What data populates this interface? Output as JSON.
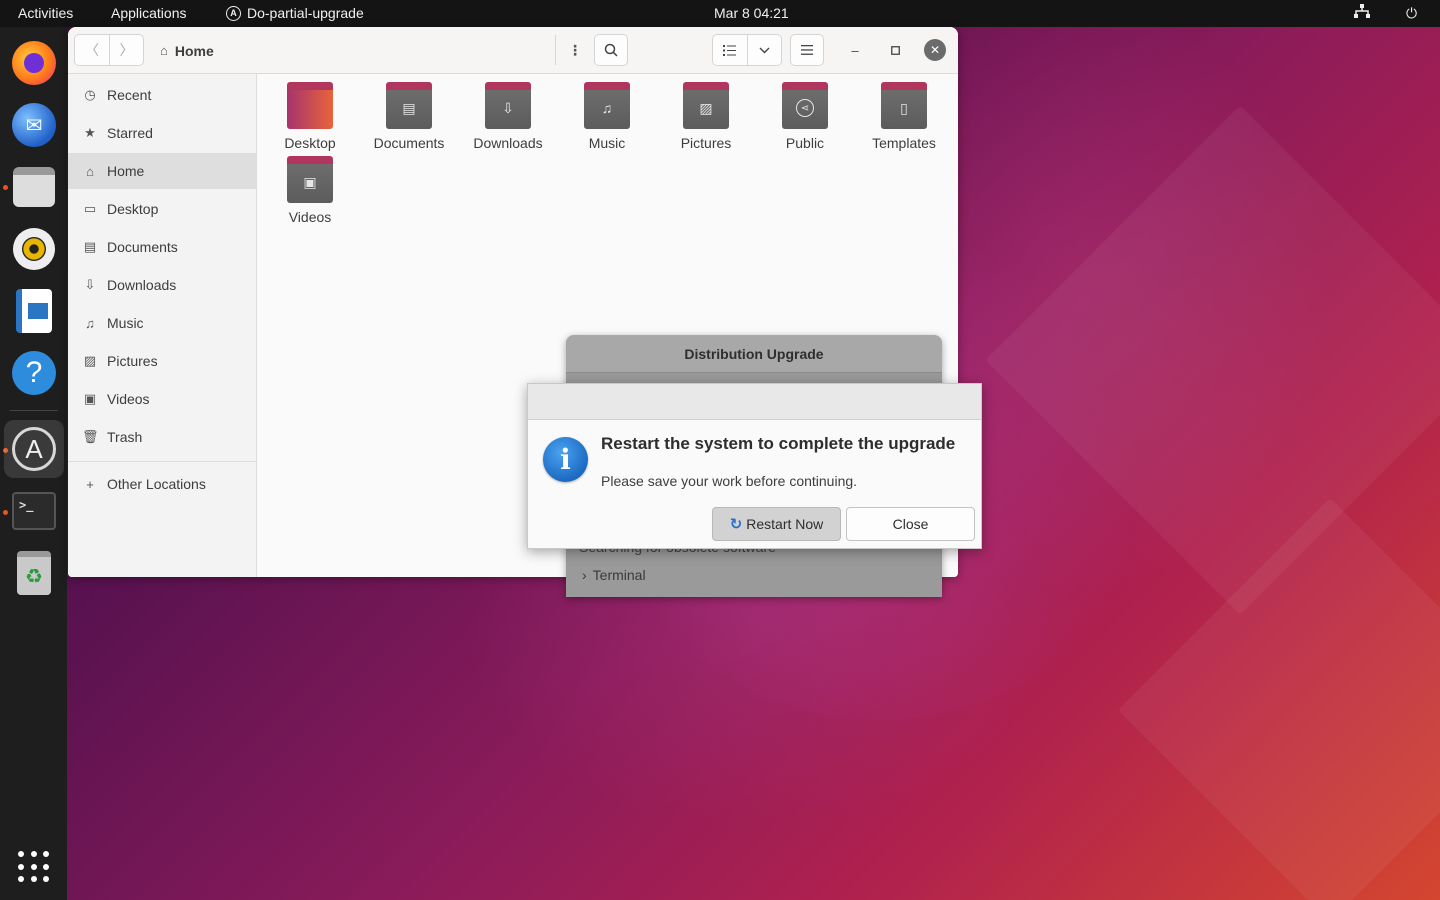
{
  "topbar": {
    "activities": "Activities",
    "applications": "Applications",
    "app_name": "Do-partial-upgrade",
    "clock": "Mar 8  04:21"
  },
  "dock": {
    "items": [
      {
        "name": "firefox",
        "icon": "firefox-icon"
      },
      {
        "name": "thunderbird",
        "icon": "thunderbird-icon"
      },
      {
        "name": "files",
        "icon": "files-icon"
      },
      {
        "name": "rhythmbox",
        "icon": "rhythmbox-icon"
      },
      {
        "name": "libreoffice-writer",
        "icon": "writer-icon"
      },
      {
        "name": "help",
        "icon": "help-icon",
        "glyph": "?"
      },
      {
        "name": "software-updater",
        "icon": "software-updater-icon",
        "glyph": "A"
      },
      {
        "name": "terminal",
        "icon": "terminal-icon",
        "glyph": ">_"
      },
      {
        "name": "trash",
        "icon": "trash-icon",
        "glyph": "♻"
      },
      {
        "name": "show-applications",
        "icon": "app-grid-icon"
      }
    ]
  },
  "files": {
    "location": "Home",
    "sidebar": [
      {
        "label": "Recent",
        "icon": "clock-icon"
      },
      {
        "label": "Starred",
        "icon": "star-icon"
      },
      {
        "label": "Home",
        "icon": "home-icon",
        "selected": true
      },
      {
        "label": "Desktop",
        "icon": "desktop-icon"
      },
      {
        "label": "Documents",
        "icon": "document-icon"
      },
      {
        "label": "Downloads",
        "icon": "download-icon"
      },
      {
        "label": "Music",
        "icon": "music-icon"
      },
      {
        "label": "Pictures",
        "icon": "picture-icon"
      },
      {
        "label": "Videos",
        "icon": "video-icon"
      },
      {
        "label": "Trash",
        "icon": "trash-icon"
      },
      {
        "label": "Other Locations",
        "icon": "plus-icon"
      }
    ],
    "folders": [
      {
        "label": "Desktop"
      },
      {
        "label": "Documents"
      },
      {
        "label": "Downloads"
      },
      {
        "label": "Music"
      },
      {
        "label": "Pictures"
      },
      {
        "label": "Public"
      },
      {
        "label": "Templates"
      },
      {
        "label": "Videos"
      }
    ]
  },
  "upgrade_window": {
    "title": "Distribution Upgrade",
    "status": "Searching for obsolete software",
    "terminal_label": "Terminal"
  },
  "dialog": {
    "title": "Restart the system to complete the upgrade",
    "message": "Please save your work before continuing.",
    "restart_label": "Restart Now",
    "close_label": "Close",
    "info_glyph": "i"
  },
  "colors": {
    "accent": "#e95420",
    "info_blue": "#1a66c0"
  }
}
